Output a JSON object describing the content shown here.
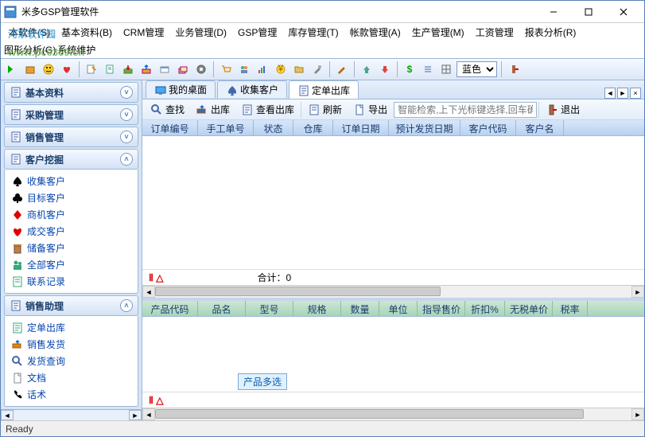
{
  "title": "米多GSP管理软件",
  "watermark": "河东软件园",
  "watermark_url": "www.pc0359.cn",
  "menus": [
    "本软件(S)",
    "基本资料(B)",
    "CRM管理",
    "业务管理(D)",
    "GSP管理",
    "库存管理(T)",
    "帐款管理(A)",
    "生产管理(M)",
    "工资管理",
    "报表分析(R)"
  ],
  "menus2": [
    "图形分析(G)",
    "系统维护"
  ],
  "theme_label": "蓝色",
  "sidebar": {
    "groups": [
      {
        "id": "basic",
        "title": "基本资料",
        "expanded": false
      },
      {
        "id": "purchase",
        "title": "采购管理",
        "expanded": false
      },
      {
        "id": "sales",
        "title": "销售管理",
        "expanded": false
      },
      {
        "id": "crm",
        "title": "客户挖掘",
        "expanded": true,
        "items": [
          {
            "icon": "spade",
            "color": "#000",
            "label": "收集客户"
          },
          {
            "icon": "club",
            "color": "#000",
            "label": "目标客户"
          },
          {
            "icon": "diamond",
            "color": "#d00",
            "label": "商机客户"
          },
          {
            "icon": "heart",
            "color": "#d00",
            "label": "成交客户"
          },
          {
            "icon": "trash",
            "color": "#c08040",
            "label": "储备客户"
          },
          {
            "icon": "people",
            "color": "#3a7",
            "label": "全部客户"
          },
          {
            "icon": "note",
            "color": "#3a7",
            "label": "联系记录"
          }
        ]
      },
      {
        "id": "assist",
        "title": "销售助理",
        "expanded": true,
        "items": [
          {
            "icon": "doc",
            "color": "#3a7",
            "label": "定单出库"
          },
          {
            "icon": "ship",
            "color": "#d80",
            "label": "销售发货"
          },
          {
            "icon": "search",
            "color": "#46a",
            "label": "发货查询"
          },
          {
            "icon": "file",
            "color": "#888",
            "label": "文档"
          },
          {
            "icon": "phone",
            "color": "#000",
            "label": "话术"
          }
        ]
      }
    ]
  },
  "tabs": [
    {
      "icon": "desktop",
      "label": "我的桌面"
    },
    {
      "icon": "spade",
      "label": "收集客户"
    },
    {
      "icon": "doc",
      "label": "定单出库",
      "active": true
    }
  ],
  "subtoolbar": [
    {
      "icon": "find",
      "label": "查找"
    },
    {
      "icon": "out",
      "label": "出库"
    },
    {
      "icon": "view",
      "label": "查看出库"
    },
    {
      "sep": true
    },
    {
      "icon": "refresh",
      "label": "刷新"
    },
    {
      "icon": "export",
      "label": "导出"
    }
  ],
  "search_placeholder": "智能检索,上下光标键选择,回车确认",
  "exit_label": "退出",
  "upper_columns": [
    "订单编号",
    "手工单号",
    "状态",
    "仓库",
    "订单日期",
    "预计发货日期",
    "客户代码",
    "客户名"
  ],
  "upper_widths": [
    70,
    70,
    50,
    50,
    70,
    90,
    70,
    60
  ],
  "summary_mark": "Ⅱ △",
  "summary_text": "合计：0",
  "lower_columns": [
    "产品代码",
    "品名",
    "型号",
    "规格",
    "数量",
    "单位",
    "指导售价",
    "折扣%",
    "无税单价",
    "税率"
  ],
  "lower_widths": [
    70,
    60,
    60,
    60,
    48,
    48,
    60,
    50,
    60,
    44
  ],
  "multi_select": "产品多选",
  "status": "Ready"
}
